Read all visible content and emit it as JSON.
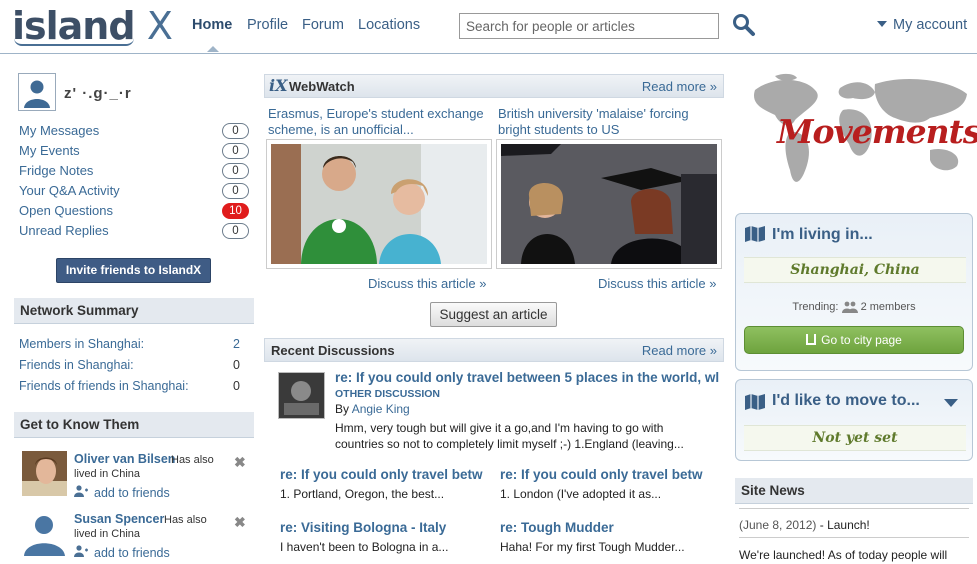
{
  "header": {
    "logo": "island",
    "logo_x": "X",
    "nav": [
      "Home",
      "Profile",
      "Forum",
      "Locations"
    ],
    "search_placeholder": "Search for people or articles",
    "account": "My account"
  },
  "sidebar": {
    "username": "z' ·.g·_·r",
    "menu": [
      {
        "label": "My Messages",
        "count": "0"
      },
      {
        "label": "My Events",
        "count": "0"
      },
      {
        "label": "Fridge Notes",
        "count": "0"
      },
      {
        "label": "Your Q&A Activity",
        "count": "0"
      },
      {
        "label": "Open Questions",
        "count": "10"
      },
      {
        "label": "Unread Replies",
        "count": "0"
      }
    ],
    "invite": "Invite friends to IslandX",
    "network_title": "Network Summary",
    "network": [
      {
        "label": "Members in Shanghai:",
        "value": "2"
      },
      {
        "label": "Friends in Shanghai:",
        "value": "0"
      },
      {
        "label": "Friends of friends in Shanghai:",
        "value": "0"
      }
    ],
    "know_title": "Get to Know Them",
    "people": [
      {
        "name": "Oliver van Bilsen",
        "info_tail": "Has also",
        "info2": "lived in China",
        "add": "add to friends"
      },
      {
        "name": "Susan Spencer",
        "info_tail": "Has also",
        "info2": "lived in China",
        "add": "add to friends"
      }
    ]
  },
  "webwatch": {
    "title": "WebWatch",
    "read_more": "Read more »",
    "articles": [
      {
        "title": "Erasmus, Europe's student exchange scheme, is an unofficial...",
        "discuss": "Discuss this article »"
      },
      {
        "title": "British university 'malaise' forcing bright students to US",
        "discuss": "Discuss this article »"
      }
    ],
    "suggest": "Suggest an article"
  },
  "discussions": {
    "title": "Recent Discussions",
    "read_more": "Read more »",
    "featured": {
      "title": "re: If you could only travel between 5 places in the world, wl",
      "tag": "OTHER DISCUSSION",
      "by": "By",
      "author": "Angie King",
      "line1": "Hmm, very tough but will give it a go,and I'm having to go with",
      "line2": "countries so not to completely limit myself ;-) 1.England (leaving..."
    },
    "items": [
      {
        "title": "re: If you could only travel betw",
        "text": "1. Portland, Oregon, the best..."
      },
      {
        "title": "re: If you could only travel betw",
        "text": "1. London (I've adopted it as..."
      },
      {
        "title": "re: Visiting Bologna - Italy",
        "text": "I haven't been to Bologna in a..."
      },
      {
        "title": "re: Tough Mudder",
        "text": "Haha! For my first Tough Mudder..."
      }
    ]
  },
  "right": {
    "movements": "Movements",
    "living_title": "I'm living in...",
    "living_city": "Shanghai, China",
    "trending_label": "Trending:",
    "trending_value": "2 members",
    "goto": "Go to city page",
    "move_title": "I'd like to move to...",
    "move_value": "Not yet set",
    "news_title": "Site News",
    "news_date": "(June 8, 2012)",
    "news_head": "- Launch!",
    "news_text": "We're launched!  As of today people will"
  },
  "colors": {
    "accent": "#3a6a96",
    "brand": "#3d4f66",
    "badge_red": "#e01c1c",
    "green": "#6ea33e"
  }
}
